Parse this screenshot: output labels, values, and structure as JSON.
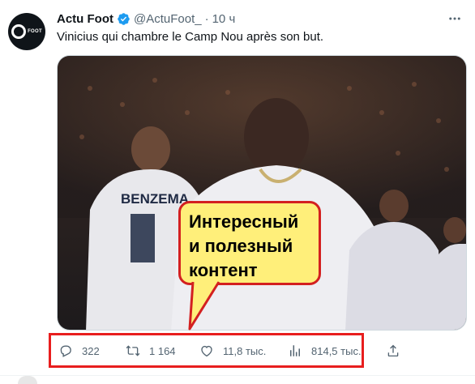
{
  "tweet": {
    "author_name": "Actu Foot",
    "handle": "@ActuFoot_",
    "separator": "·",
    "time": "10 ч",
    "text": "Vinicius qui chambre le Camp Nou après son but.",
    "avatar_text": "FOOT",
    "verified_color": "#1d9bf0"
  },
  "media": {
    "jersey_name": "BENZEMA"
  },
  "callout": {
    "text": "Интересный\nи полезный\nконтент",
    "background": "#ffef7a",
    "border_color": "#d32020"
  },
  "actions": {
    "reply_count": "322",
    "retweet_count": "1 164",
    "like_count": "11,8 тыс.",
    "views_count": "814,5 тыс.",
    "highlight_color": "#e81e1e"
  },
  "icons": [
    "verified-icon",
    "more-icon",
    "reply-icon",
    "retweet-icon",
    "like-icon",
    "views-icon",
    "share-icon"
  ]
}
